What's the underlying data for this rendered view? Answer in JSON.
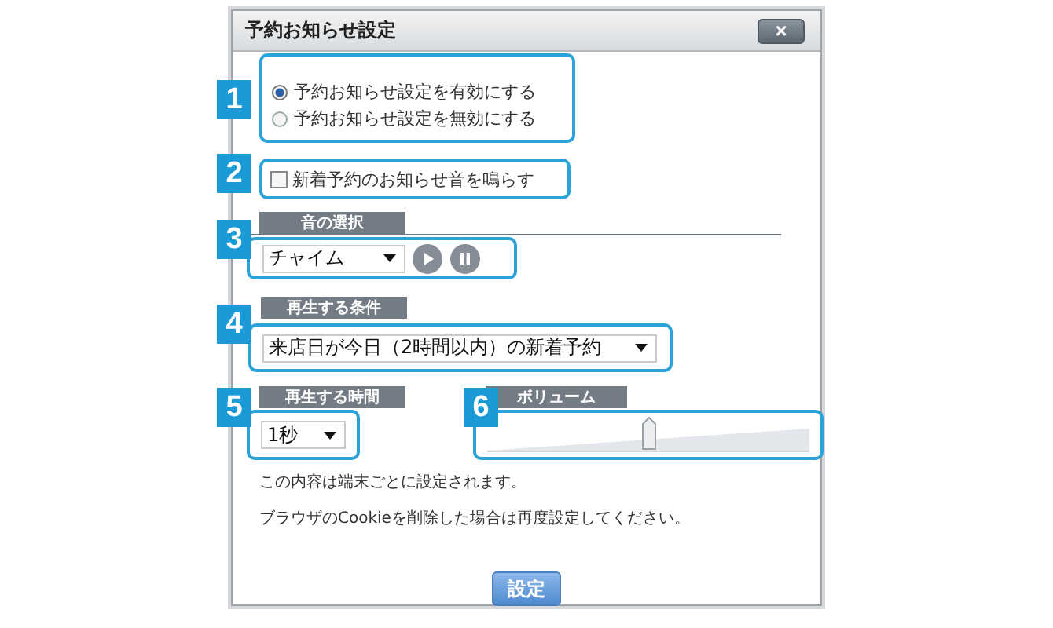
{
  "window": {
    "title": "予約お知らせ設定",
    "close": "×"
  },
  "notify": {
    "badge": "1",
    "options": [
      {
        "label": "予約お知らせ設定を有効にする",
        "selected": true
      },
      {
        "label": "予約お知らせ設定を無効にする",
        "selected": false
      }
    ]
  },
  "new_sound": {
    "badge": "2",
    "label": "新着予約のお知らせ音を鳴らす",
    "checked": false
  },
  "sound": {
    "badge": "3",
    "heading": "音の選択",
    "value": "チャイム"
  },
  "condition": {
    "badge": "4",
    "heading": "再生する条件",
    "value": "来店日が今日（2時間以内）の新着予約"
  },
  "duration": {
    "badge": "5",
    "heading": "再生する時間",
    "value": "1秒"
  },
  "volume": {
    "badge": "6",
    "heading": "ボリューム",
    "level": 0.5
  },
  "notes": [
    "この内容は端末ごとに設定されます。",
    "ブラウザのCookieを削除した場合は再度設定してください。"
  ],
  "submit": "設定"
}
